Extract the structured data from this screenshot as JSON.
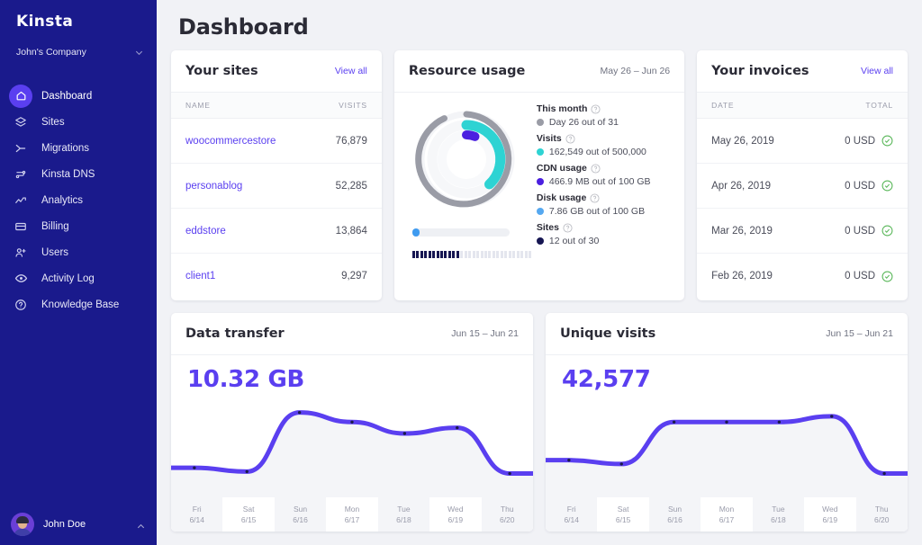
{
  "sidebar": {
    "logo": "Kinsta",
    "company": "John's Company",
    "company_chevron_icon": "chevron-down-icon",
    "items": [
      {
        "label": "Dashboard",
        "icon": "home-icon",
        "active": true
      },
      {
        "label": "Sites",
        "icon": "layers-icon",
        "active": false
      },
      {
        "label": "Migrations",
        "icon": "migrate-icon",
        "active": false
      },
      {
        "label": "Kinsta DNS",
        "icon": "dns-icon",
        "active": false
      },
      {
        "label": "Analytics",
        "icon": "analytics-icon",
        "active": false
      },
      {
        "label": "Billing",
        "icon": "card-icon",
        "active": false
      },
      {
        "label": "Users",
        "icon": "user-add-icon",
        "active": false
      },
      {
        "label": "Activity Log",
        "icon": "eye-icon",
        "active": false
      },
      {
        "label": "Knowledge Base",
        "icon": "help-icon",
        "active": false
      }
    ],
    "user": {
      "name": "John Doe",
      "caret_icon": "chevron-up-icon"
    }
  },
  "header": {
    "title": "Dashboard"
  },
  "sites_card": {
    "title": "Your sites",
    "view_all": "View all",
    "columns": [
      "NAME",
      "VISITS"
    ],
    "rows": [
      {
        "name": "woocommercestore",
        "visits": "76,879"
      },
      {
        "name": "personablog",
        "visits": "52,285"
      },
      {
        "name": "eddstore",
        "visits": "13,864"
      },
      {
        "name": "client1",
        "visits": "9,297"
      }
    ]
  },
  "resource_card": {
    "title": "Resource usage",
    "date_range": "May 26 – Jun 26",
    "metrics": [
      {
        "label": "This month",
        "value": "Day 26 out of 31",
        "color": "#9a9ca6",
        "help_icon": "question-circle-icon"
      },
      {
        "label": "Visits",
        "value": "162,549 out of 500,000",
        "color": "#2ed3d3",
        "help_icon": "question-circle-icon"
      },
      {
        "label": "CDN usage",
        "value": "466.9 MB out of 100 GB",
        "color": "#4b1fe0",
        "help_icon": "question-circle-icon"
      },
      {
        "label": "Disk usage",
        "value": "7.86 GB out of 100 GB",
        "color": "#55a8f0",
        "help_icon": "question-circle-icon"
      },
      {
        "label": "Sites",
        "value": "12 out of 30",
        "color": "#161652",
        "help_icon": "question-circle-icon"
      }
    ],
    "rings": [
      {
        "name": "This month",
        "percent": 83.9,
        "color": "#9a9ca6"
      },
      {
        "name": "Visits",
        "percent": 32.5,
        "color": "#2ed3d3"
      },
      {
        "name": "CDN usage",
        "percent": 4.6,
        "color": "#4b1fe0"
      }
    ],
    "disk_bar": {
      "percent": 7.9,
      "color": "#3f9bf0"
    },
    "sites_squares": {
      "filled": 12,
      "total": 30,
      "on_color": "#161652",
      "off_color": "#e4e6ee"
    }
  },
  "invoices_card": {
    "title": "Your invoices",
    "view_all": "View all",
    "columns": [
      "DATE",
      "TOTAL"
    ],
    "rows": [
      {
        "date": "May 26, 2019",
        "total": "0 USD",
        "status_icon": "check-circle-icon"
      },
      {
        "date": "Apr 26, 2019",
        "total": "0 USD",
        "status_icon": "check-circle-icon"
      },
      {
        "date": "Mar 26, 2019",
        "total": "0 USD",
        "status_icon": "check-circle-icon"
      },
      {
        "date": "Feb 26, 2019",
        "total": "0 USD",
        "status_icon": "check-circle-icon"
      }
    ]
  },
  "chart_data": [
    {
      "type": "line",
      "title": "Data transfer",
      "date_range": "Jun 15 – Jun 21",
      "total_label": "10.32 GB",
      "xlabel": "",
      "ylabel": "",
      "grid": false,
      "legend": "none",
      "line_color": "#5a3ff0",
      "categories": [
        "Fri",
        "Sat",
        "Sun",
        "Mon",
        "Tue",
        "Wed",
        "Thu"
      ],
      "tick_dates": [
        "6/14",
        "6/15",
        "6/16",
        "6/17",
        "6/18",
        "6/19",
        "6/20"
      ],
      "x": [
        0,
        1,
        2,
        3,
        4,
        5,
        6
      ],
      "values": [
        14,
        10,
        72,
        62,
        50,
        56,
        8
      ],
      "ylim": [
        0,
        100
      ]
    },
    {
      "type": "line",
      "title": "Unique visits",
      "date_range": "Jun 15 – Jun 21",
      "total_label": "42,577",
      "xlabel": "",
      "ylabel": "",
      "grid": false,
      "legend": "none",
      "line_color": "#5a3ff0",
      "categories": [
        "Fri",
        "Sat",
        "Sun",
        "Mon",
        "Tue",
        "Wed",
        "Thu"
      ],
      "tick_dates": [
        "6/14",
        "6/15",
        "6/16",
        "6/17",
        "6/18",
        "6/19",
        "6/20"
      ],
      "x": [
        0,
        1,
        2,
        3,
        4,
        5,
        6
      ],
      "values": [
        22,
        18,
        62,
        62,
        62,
        68,
        8
      ],
      "ylim": [
        0,
        100
      ]
    }
  ],
  "colors": {
    "sidebar_bg": "#1a1a8c",
    "accent": "#5a3ff0",
    "page_bg": "#f1f2f6",
    "card_bg": "#ffffff",
    "success": "#5cb85c"
  }
}
